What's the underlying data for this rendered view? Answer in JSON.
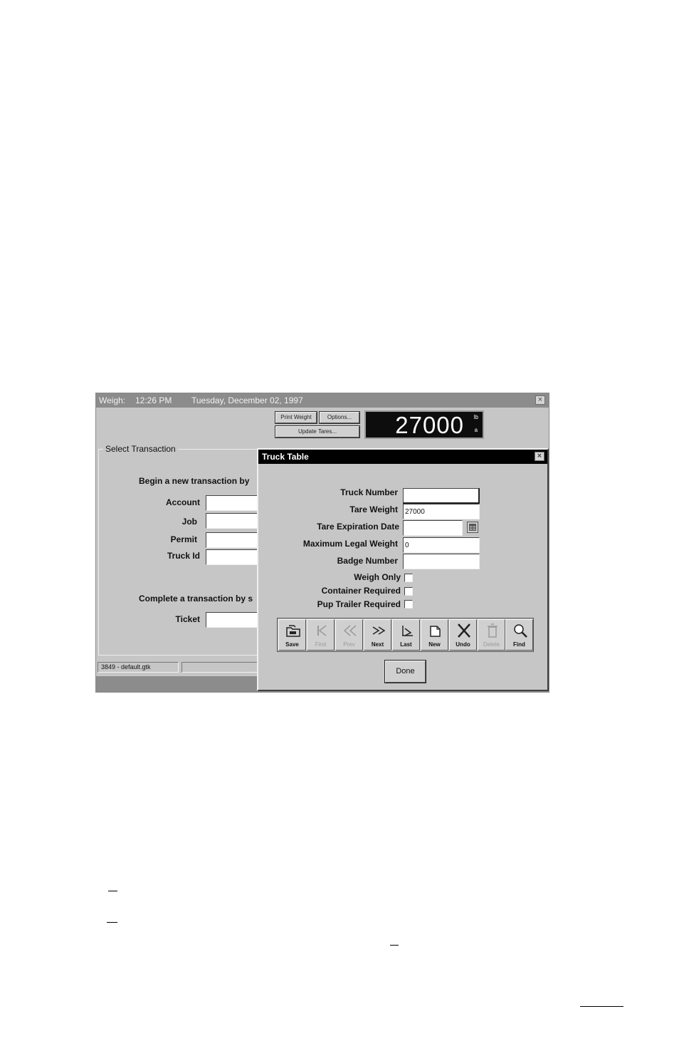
{
  "weigh_window": {
    "title_app": "Weigh:",
    "title_time": "12:26 PM",
    "title_date": "Tuesday, December 02, 1997",
    "close_glyph": "×",
    "print_weight_label": "Print Weight",
    "options_label": "Options...",
    "update_tares_label": "Update Tares...",
    "weight_value": "27000",
    "weight_unit_top": "lb",
    "weight_unit_bottom": "a",
    "select_group_title": "Select Transaction",
    "begin_text": "Begin a new transaction by",
    "account_label": "Account",
    "job_label": "Job",
    "permit_label": "Permit",
    "truck_id_label": "Truck Id",
    "complete_text": "Complete a transaction by s",
    "ticket_label": "Ticket",
    "status_text": "3849 - default.gtk",
    "status_text_2": ""
  },
  "truck_table": {
    "title": "Truck Table",
    "close_glyph": "×",
    "truck_number_label": "Truck Number",
    "truck_number_value": "",
    "tare_weight_label": "Tare Weight",
    "tare_weight_value": "27000",
    "tare_expiration_label": "Tare Expiration Date",
    "tare_expiration_value": "",
    "max_legal_weight_label": "Maximum Legal Weight",
    "max_legal_weight_value": "0",
    "badge_number_label": "Badge Number",
    "badge_number_value": "",
    "weigh_only_label": "Weigh Only",
    "container_required_label": "Container Required",
    "pup_trailer_label": "Pup Trailer Required",
    "toolbar": [
      {
        "label": "Save",
        "icon": "save-icon",
        "enabled": true
      },
      {
        "label": "First",
        "icon": "first-icon",
        "enabled": false
      },
      {
        "label": "Prev",
        "icon": "prev-icon",
        "enabled": false
      },
      {
        "label": "Next",
        "icon": "next-icon",
        "enabled": true
      },
      {
        "label": "Last",
        "icon": "last-icon",
        "enabled": true
      },
      {
        "label": "New",
        "icon": "new-icon",
        "enabled": true
      },
      {
        "label": "Undo",
        "icon": "undo-icon",
        "enabled": true
      },
      {
        "label": "Delete",
        "icon": "delete-icon",
        "enabled": false
      },
      {
        "label": "Find",
        "icon": "find-icon",
        "enabled": true
      }
    ],
    "done_label": "Done"
  }
}
